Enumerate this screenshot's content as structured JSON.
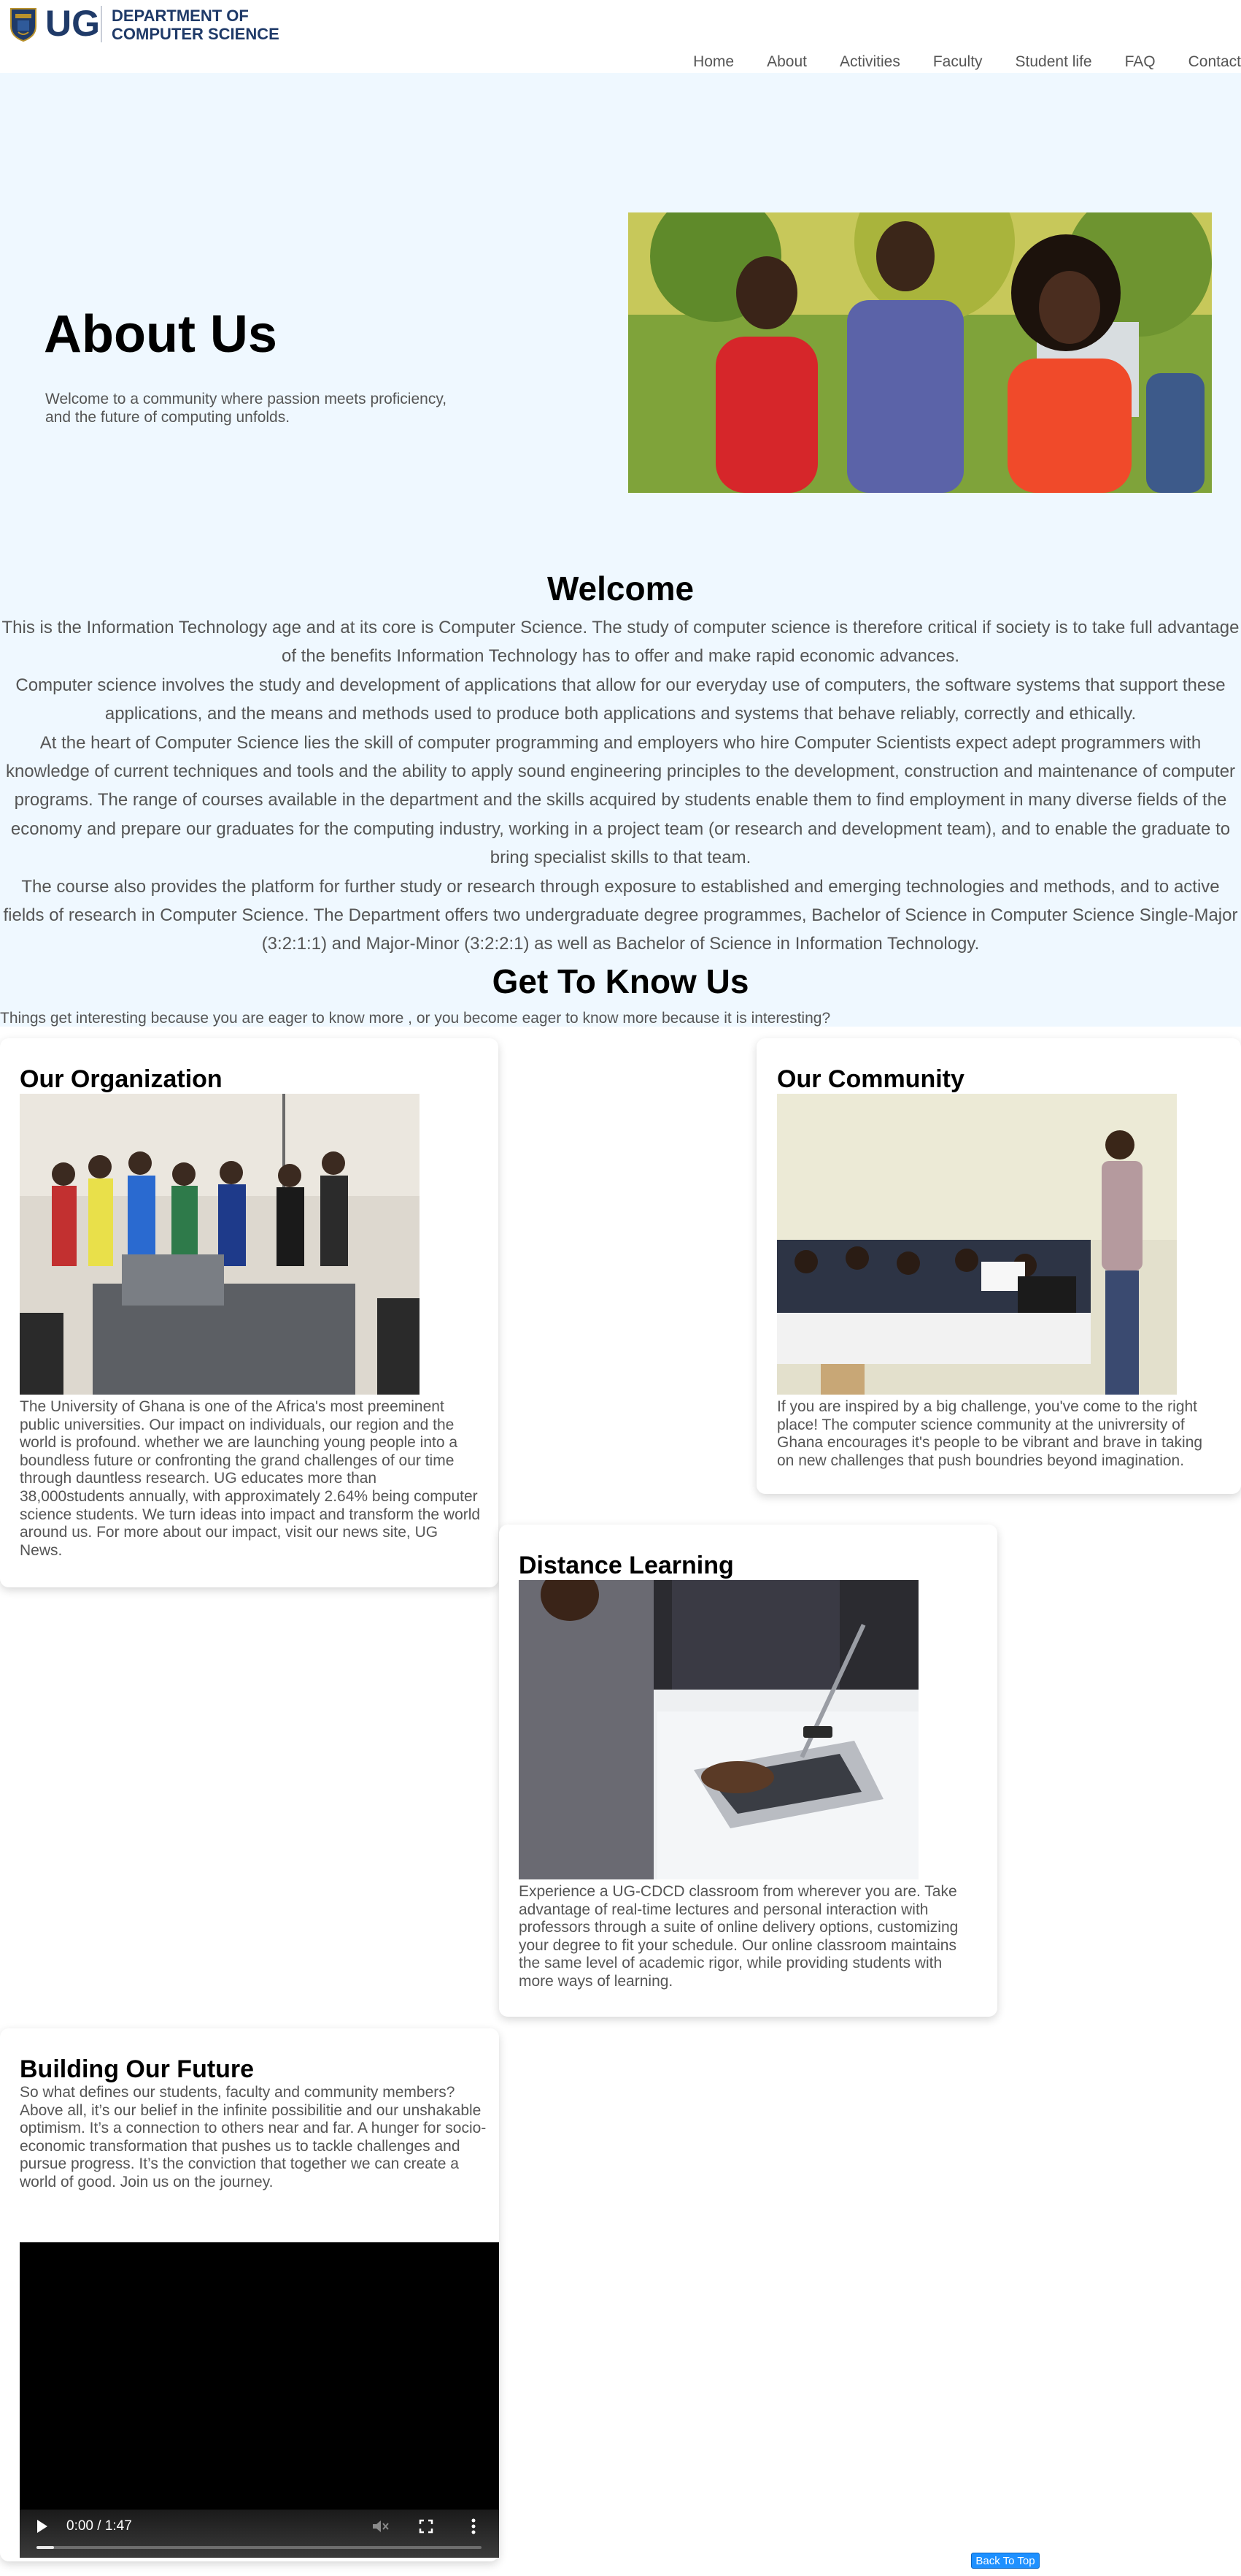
{
  "header": {
    "logo_text": "UG",
    "dept_line1": "DEPARTMENT OF",
    "dept_line2": "COMPUTER SCIENCE",
    "nav": [
      "Home",
      "About",
      "Activities",
      "Faculty",
      "Student life",
      "FAQ",
      "Contact"
    ]
  },
  "hero": {
    "title": "About Us",
    "subtitle": "Welcome to a community where passion meets proficiency, and the future of computing unfolds."
  },
  "welcome": {
    "title": "Welcome",
    "paragraphs": [
      "This is the Information Technology age and at its core is Computer Science. The study of computer science is therefore critical if society is to take full advantage of the benefits Information Technology has to offer and make rapid economic advances.",
      "Computer science involves the study and development of applications that allow for our everyday use of computers, the software systems that support these applications, and the means and methods used to produce both applications and systems that behave reliably, correctly and ethically.",
      "At the heart of Computer Science lies the skill of computer programming and employers who hire Computer Scientists expect adept programmers with knowledge of current techniques and tools and the ability to apply sound engineering principles to the development, construction and maintenance of computer programs. The range of courses available in the department and the skills acquired by students enable them to find employment in many diverse fields of the economy and prepare our graduates for the computing industry, working in a project team (or research and development team), and to enable the graduate to bring specialist skills to that team.",
      "The course also provides the platform for further study or research through exposure to established and emerging technologies and methods, and to active fields of research in Computer Science. The Department offers two undergraduate degree programmes, Bachelor of Science in Computer Science Single-Major (3:2:1:1) and Major-Minor (3:2:2:1) as well as Bachelor of Science in Information Technology."
    ]
  },
  "get_to_know": {
    "title": "Get To Know Us",
    "subtitle": "Things get interesting because you are eager to know more , or you become eager to know more because it is interesting?"
  },
  "cards": {
    "organization": {
      "title": "Our Organization",
      "text": "The University of Ghana is one of the Africa's most preeminent public universities. Our impact on individuals, our region and the world is profound. whether we are launching young people into a boundless future or confronting the grand challenges of our time through dauntless research. UG educates more than 38,000students annually, with approximately 2.64% being computer science students. We turn ideas into impact and transform the world around us. For more about our impact, visit our news site, UG News."
    },
    "community": {
      "title": "Our Community",
      "text": "If you are inspired by a big challenge, you've come to the right place! The computer science community at the univrersity of Ghana encourages it's people to be vibrant and brave in taking on new challenges that push boundries beyond imagination."
    },
    "distance": {
      "title": "Distance Learning",
      "text": "Experience a UG-CDCD classroom from wherever you are. Take advantage of real-time lectures and personal interaction with professors through a suite of online delivery options, customizing your degree to fit your schedule. Our online classroom maintains the same level of academic rigor, while providing students with more ways of learning."
    },
    "future": {
      "title": "Building Our Future",
      "text": "So what defines our students, faculty and community members? Above all, it’s our belief in the infinite possibilitie and our unshakable optimism. It’s a connection to others near and far. A hunger for socio-economic transformation that pushes us to tackle challenges and pursue progress. It’s the conviction that together we can create a world of good. Join us on the journey."
    }
  },
  "video": {
    "time": "0:00 / 1:47",
    "progress": 0.04
  },
  "back_to_top": "Back To Top",
  "icons": {
    "crest": "ug-crest-icon",
    "play": "play-icon",
    "mute": "volume-muted-icon",
    "fullscreen": "fullscreen-icon",
    "more": "more-vert-icon"
  },
  "colors": {
    "brand_navy": "#1f3a68",
    "hero_bg": "#eff8ff",
    "text_grey": "#555555",
    "button_blue": "#1e90ff"
  }
}
